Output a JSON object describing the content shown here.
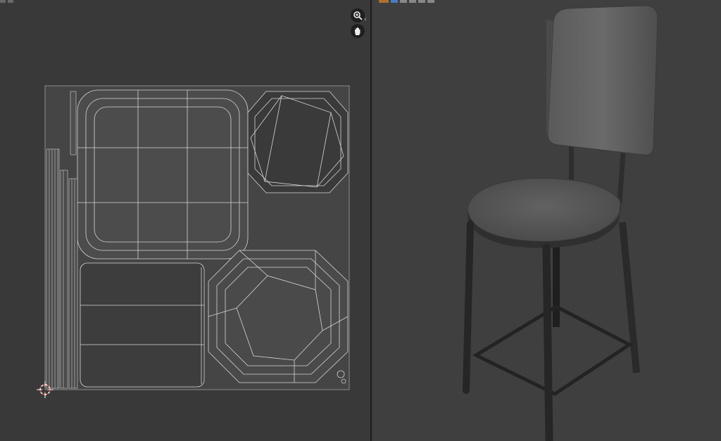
{
  "colors": {
    "uv_background": "#393939",
    "viewport_background": "#3f3f3f",
    "uv_wire": "#d8d8d8",
    "chair_fabric": "#5a5a5a",
    "chair_metal": "#2a2a2a"
  },
  "uv_editor": {
    "tools": [
      {
        "icon": "zoom-in-icon"
      },
      {
        "icon": "hand-pan-icon"
      }
    ],
    "cursor_icon": "3d-cursor-icon"
  },
  "viewport": {
    "object": "bar-chair"
  }
}
